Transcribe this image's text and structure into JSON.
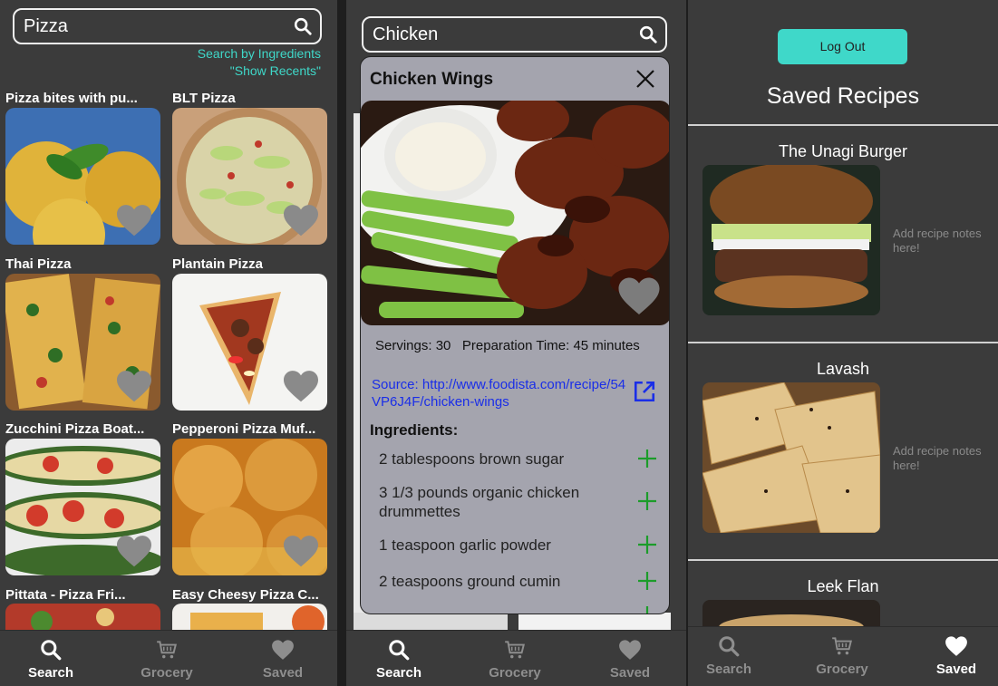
{
  "search_screen": {
    "query": "Pizza",
    "link_ingredients": "Search by Ingredients",
    "link_recents": "\"Show Recents\"",
    "results": [
      {
        "title": "Pizza bites with pu..."
      },
      {
        "title": "BLT Pizza"
      },
      {
        "title": "Thai Pizza"
      },
      {
        "title": "Plantain Pizza"
      },
      {
        "title": "Zucchini Pizza Boat..."
      },
      {
        "title": "Pepperoni Pizza Muf..."
      },
      {
        "title": "Pittata - Pizza Fri..."
      },
      {
        "title": "Easy Cheesy Pizza C..."
      }
    ]
  },
  "detail_screen": {
    "query": "Chicken",
    "title": "Chicken Wings",
    "servings_line": "Servings: 30   Preparation Time: 45 minutes",
    "source": "Source: http://www.foodista.com/recipe/54VP6J4F/chicken-wings",
    "ingredients_heading": "Ingredients:",
    "ingredients": [
      "2 tablespoons brown sugar",
      "3 1/3 pounds organic chicken drummettes",
      "1 teaspoon garlic powder",
      "2 teaspoons ground cumin"
    ]
  },
  "saved_screen": {
    "logout_label": "Log Out",
    "title": "Saved Recipes",
    "notes_placeholder": "Add recipe notes here!",
    "recipes": [
      {
        "name": "The Unagi Burger"
      },
      {
        "name": "Lavash"
      },
      {
        "name": "Leek Flan"
      }
    ]
  },
  "nav": {
    "search": "Search",
    "grocery": "Grocery",
    "saved": "Saved"
  },
  "colors": {
    "accent": "#3fd8c9",
    "background": "#3b3b3b",
    "modal": "#a4a4ae",
    "link": "#1a2ee8",
    "plus": "#1c9c2a"
  }
}
